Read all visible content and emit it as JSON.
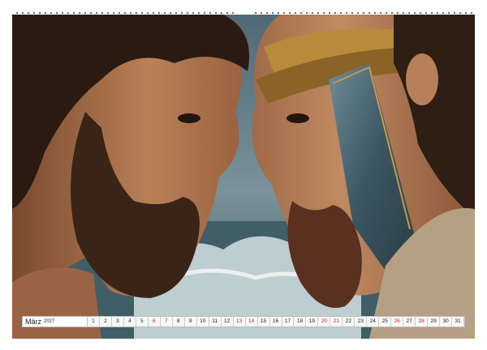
{
  "calendar": {
    "month": "März",
    "year": "2027",
    "days": [
      {
        "n": "1",
        "weekend": false
      },
      {
        "n": "2",
        "weekend": false
      },
      {
        "n": "3",
        "weekend": false
      },
      {
        "n": "4",
        "weekend": false
      },
      {
        "n": "5",
        "weekend": false
      },
      {
        "n": "6",
        "weekend": true
      },
      {
        "n": "7",
        "weekend": true
      },
      {
        "n": "8",
        "weekend": false
      },
      {
        "n": "9",
        "weekend": false
      },
      {
        "n": "10",
        "weekend": false
      },
      {
        "n": "11",
        "weekend": false
      },
      {
        "n": "12",
        "weekend": false
      },
      {
        "n": "13",
        "weekend": true
      },
      {
        "n": "14",
        "weekend": true
      },
      {
        "n": "15",
        "weekend": false
      },
      {
        "n": "16",
        "weekend": false
      },
      {
        "n": "17",
        "weekend": false
      },
      {
        "n": "18",
        "weekend": false
      },
      {
        "n": "19",
        "weekend": false
      },
      {
        "n": "20",
        "weekend": true
      },
      {
        "n": "21",
        "weekend": true
      },
      {
        "n": "22",
        "weekend": false
      },
      {
        "n": "23",
        "weekend": false
      },
      {
        "n": "24",
        "weekend": false
      },
      {
        "n": "25",
        "weekend": false
      },
      {
        "n": "26",
        "weekend": true
      },
      {
        "n": "27",
        "weekend": false
      },
      {
        "n": "28",
        "weekend": true
      },
      {
        "n": "29",
        "weekend": false
      },
      {
        "n": "30",
        "weekend": false
      },
      {
        "n": "31",
        "weekend": false
      }
    ]
  },
  "colors": {
    "weekend": "#c0262d",
    "sky": "#5e7b86",
    "sea": "#3f5e66",
    "skin": "#b77c55",
    "beard": "#3a2418",
    "gold": "#b88a3c"
  }
}
